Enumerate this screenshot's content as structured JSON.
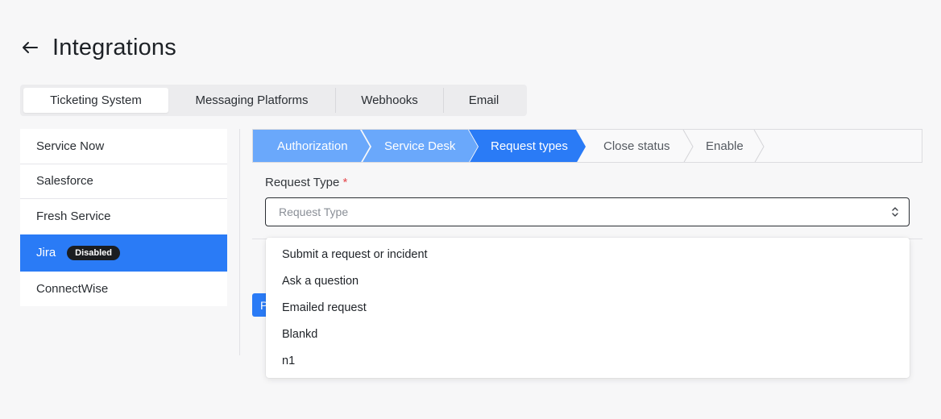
{
  "page": {
    "title": "Integrations"
  },
  "tabs": [
    {
      "label": "Ticketing System",
      "active": true
    },
    {
      "label": "Messaging Platforms",
      "active": false
    },
    {
      "label": "Webhooks",
      "active": false
    },
    {
      "label": "Email",
      "active": false
    }
  ],
  "sidebar": {
    "items": [
      {
        "label": "Service Now"
      },
      {
        "label": "Salesforce"
      },
      {
        "label": "Fresh Service"
      },
      {
        "label": "Jira",
        "badge": "Disabled",
        "active": true
      },
      {
        "label": "ConnectWise"
      }
    ]
  },
  "stepper": {
    "steps": [
      {
        "label": "Authorization",
        "state": "done"
      },
      {
        "label": "Service Desk",
        "state": "done"
      },
      {
        "label": "Request types",
        "state": "current"
      },
      {
        "label": "Close status",
        "state": "pending"
      },
      {
        "label": "Enable",
        "state": "pending"
      }
    ]
  },
  "form": {
    "request_type_label": "Request Type",
    "required_marker": "*",
    "request_type_placeholder": "Request Type",
    "partial_button_text": "P"
  },
  "dropdown": {
    "options": [
      "Submit a request or incident",
      "Ask a question",
      "Emailed request",
      "Blankd",
      "n1"
    ]
  },
  "colors": {
    "primary": "#2a7bf6",
    "step_done": "#6aa8fb",
    "step_current": "#2a7bf6",
    "badge_bg": "#1b1d20",
    "required": "#e5484d"
  }
}
